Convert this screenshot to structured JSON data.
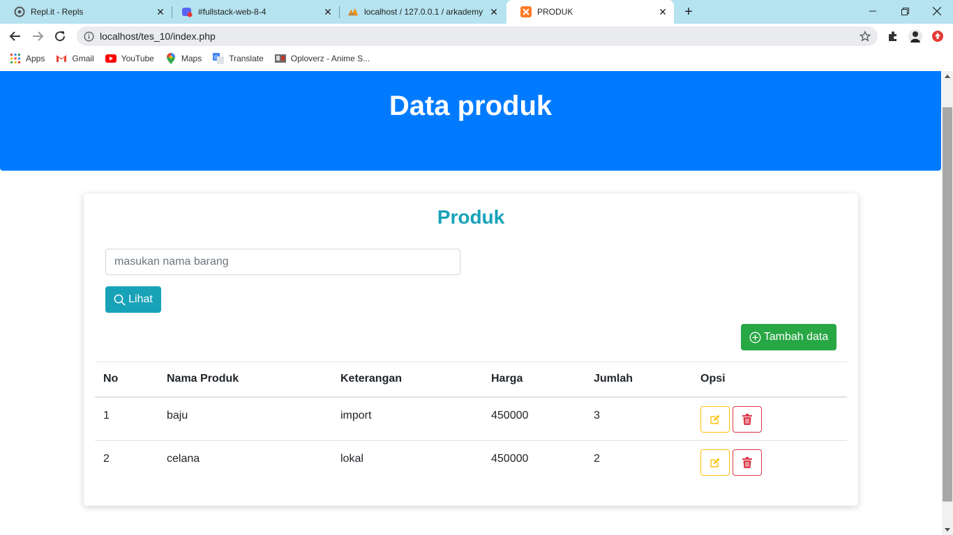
{
  "browser": {
    "tabs": [
      {
        "title": "Repl.it - Repls",
        "icon": "replit-icon"
      },
      {
        "title": "#fullstack-web-8-4",
        "icon": "discord-icon"
      },
      {
        "title": "localhost / 127.0.0.1 / arkademy",
        "icon": "phpmyadmin-icon"
      },
      {
        "title": "PRODUK",
        "icon": "xampp-icon"
      }
    ],
    "url": "localhost/tes_10/index.php",
    "bookmarks": [
      {
        "label": "Apps",
        "icon": "apps-grid-icon"
      },
      {
        "label": "Gmail",
        "icon": "gmail-icon"
      },
      {
        "label": "YouTube",
        "icon": "youtube-icon"
      },
      {
        "label": "Maps",
        "icon": "maps-pin-icon"
      },
      {
        "label": "Translate",
        "icon": "translate-icon"
      },
      {
        "label": "Oploverz - Anime S...",
        "icon": "oploverz-icon"
      }
    ]
  },
  "page": {
    "header_title": "Data produk",
    "card_title": "Produk",
    "search_placeholder": "masukan nama barang",
    "search_button": "Lihat",
    "add_button": "Tambah data",
    "columns": [
      "No",
      "Nama Produk",
      "Keterangan",
      "Harga",
      "Jumlah",
      "Opsi"
    ],
    "rows": [
      {
        "no": "1",
        "nama": "baju",
        "keterangan": "import",
        "harga": "450000",
        "jumlah": "3"
      },
      {
        "no": "2",
        "nama": "celana",
        "keterangan": "lokal",
        "harga": "450000",
        "jumlah": "2"
      }
    ]
  },
  "colors": {
    "header_bg": "#007bff",
    "card_title": "#17a2b8",
    "info_button": "#17a2b8",
    "success_button": "#28a745",
    "edit_outline": "#ffc107",
    "delete_outline": "#dc3545"
  }
}
